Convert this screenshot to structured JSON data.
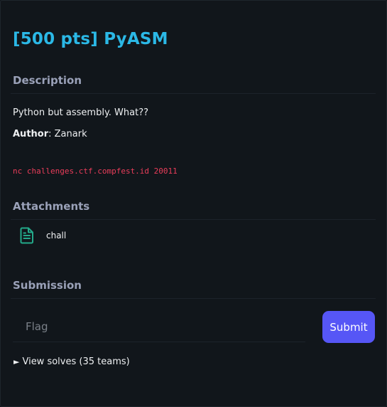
{
  "challenge": {
    "title": "[500 pts] PyASM"
  },
  "description": {
    "heading": "Description",
    "body": "Python but assembly. What??",
    "author_label": "Author",
    "author_sep": ": ",
    "author_name": "Zanark",
    "connection": "nc challenges.ctf.compfest.id 20011"
  },
  "attachments": {
    "heading": "Attachments",
    "items": [
      {
        "icon": "file-text-icon",
        "label": "chall"
      }
    ]
  },
  "submission": {
    "heading": "Submission",
    "flag_placeholder": "Flag",
    "flag_value": "",
    "submit_label": "Submit"
  },
  "solves": {
    "marker": "►",
    "label": "View solves (35 teams)"
  },
  "colors": {
    "background": "#11161b",
    "title": "#2bb8e6",
    "section_heading": "#9aa1b8",
    "code": "#ea3d5a",
    "attachment_icon": "#23a98a",
    "submit_button": "#5656f6"
  }
}
